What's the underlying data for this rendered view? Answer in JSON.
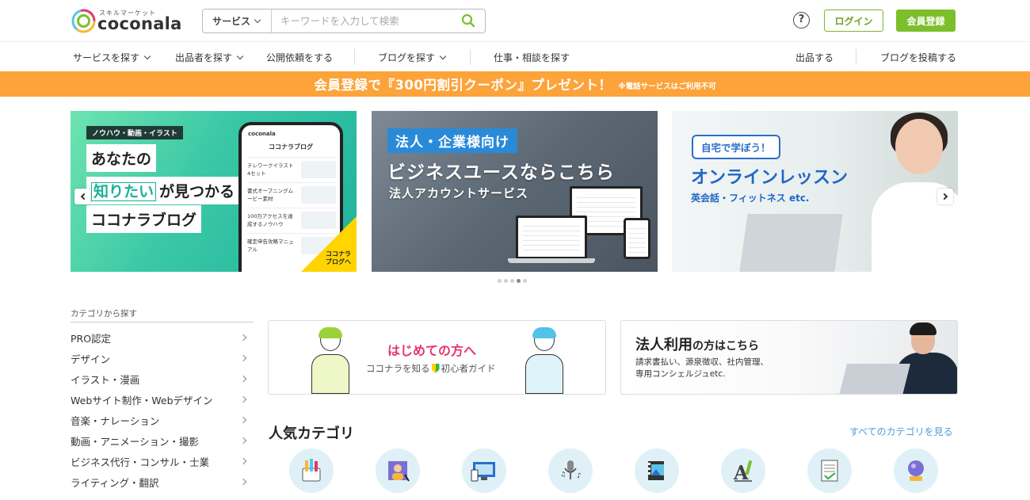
{
  "header": {
    "logo_sub": "スキルマーケット",
    "logo_word": "coconala",
    "search_category": "サービス",
    "search_placeholder": "キーワードを入力して検索",
    "help_label": "?",
    "login": "ログイン",
    "register": "会員登録"
  },
  "subnav": {
    "items": [
      "サービスを探す",
      "出品者を探す",
      "公開依頼をする",
      "ブログを探す",
      "仕事・相談を探す",
      "出品する",
      "ブログを投稿する"
    ]
  },
  "promo": {
    "main": "会員登録で『300円割引クーポン』プレゼント！",
    "note": "※電話サービスはご利用不可"
  },
  "carousel": {
    "slide1": {
      "tag": "ノウハウ・動画・イラスト",
      "line1": "あなたの",
      "line2_highlight": "知りたい",
      "line2_rest": "が見つかる",
      "line3": "ココナラブログ",
      "phone_head": "coconala",
      "phone_title": "ココナラブログ",
      "phone_rows": [
        "テレワークイラスト4セット",
        "書式オープニングムービー素材",
        "100万アクセスを達成するノウハウ",
        "確定申告攻略マニュアル"
      ],
      "corner": "ココナラブログへ"
    },
    "slide2": {
      "tag": "法人・企業様向け",
      "title": "ビジネスユースならこちら",
      "sub": "法人アカウントサービス"
    },
    "slide3": {
      "bubble": "自宅で学ぼう！",
      "title": "オンラインレッスン",
      "sub": "英会話・フィットネス etc."
    },
    "dot_count": 5,
    "active_dot": 3
  },
  "sidebar": {
    "title": "カテゴリから探す",
    "items": [
      "PRO認定",
      "デザイン",
      "イラスト・漫画",
      "Webサイト制作・Webデザイン",
      "音楽・ナレーション",
      "動画・アニメーション・撮影",
      "ビジネス代行・コンサル・士業",
      "ライティング・翻訳"
    ]
  },
  "cards": {
    "beginner": {
      "title": "はじめての方へ",
      "sub_pre": "ココナラを知る",
      "sub_post": "初心者ガイド"
    },
    "corporate": {
      "title_big": "法人利用",
      "title_small": "の方はこちら",
      "line1": "請求書払い、源泉徴収、社内管理、",
      "line2": "専用コンシェルジュetc."
    }
  },
  "popular": {
    "title": "人気カテゴリ",
    "link": "すべてのカテゴリを見る",
    "icons": [
      "design-icon",
      "illustration-icon",
      "website-icon",
      "music-icon",
      "video-icon",
      "writing-icon",
      "business-icon",
      "fortune-icon"
    ]
  },
  "colors": {
    "brand_green": "#7cbf2b",
    "promo_orange": "#fca33a",
    "accent_pink": "#e4376a",
    "link_blue": "#4a9ed8"
  }
}
